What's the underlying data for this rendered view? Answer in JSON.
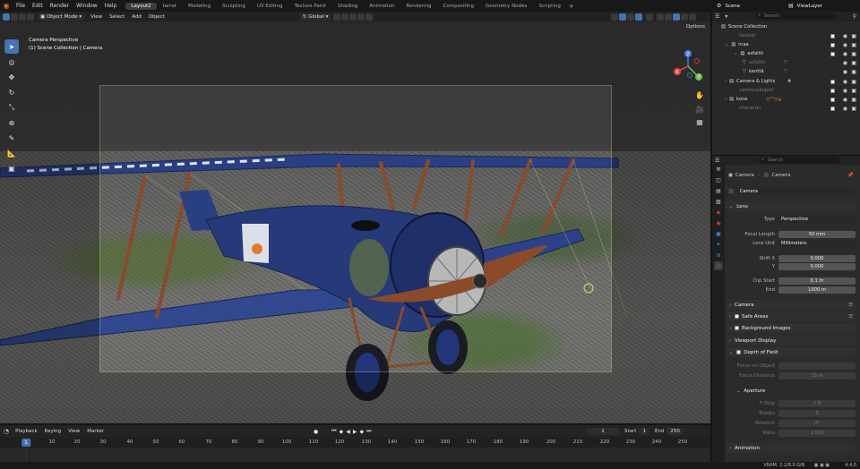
{
  "menubar": {
    "menus": [
      "File",
      "Edit",
      "Render",
      "Window",
      "Help"
    ],
    "workspaces": [
      "Layout2",
      "tarrat",
      "Modeling",
      "Sculpting",
      "UV Editing",
      "Texture Paint",
      "Shading",
      "Animation",
      "Rendering",
      "Compositing",
      "Geometry Nodes",
      "Scripting"
    ],
    "active_workspace": "Layout2",
    "scene": "Scene",
    "view_layer": "ViewLayer"
  },
  "viewport_header": {
    "mode": "Object Mode",
    "menus": [
      "View",
      "Select",
      "Add",
      "Object"
    ],
    "transform_orientation": "Global",
    "options": "Options"
  },
  "viewport": {
    "view_name": "Camera Perspective",
    "collection_path": "(1) Scene Collection | Camera",
    "gizmo_axes": [
      "Z",
      "X",
      "Y"
    ]
  },
  "timeline": {
    "menus": [
      "Playback",
      "Keying",
      "View",
      "Marker"
    ],
    "current_frame": "1",
    "start_label": "Start",
    "start": "1",
    "end_label": "End",
    "end": "250",
    "ticks": [
      "1",
      "10",
      "20",
      "30",
      "40",
      "50",
      "60",
      "70",
      "80",
      "90",
      "100",
      "110",
      "120",
      "130",
      "140",
      "150",
      "160",
      "170",
      "180",
      "190",
      "200",
      "210",
      "220",
      "230",
      "240",
      "250"
    ]
  },
  "outliner": {
    "search_placeholder": "Search",
    "rows": [
      {
        "label": "Scene Collection",
        "dim": false
      },
      {
        "label": "taustat",
        "dim": true
      },
      {
        "label": "maa",
        "dim": false
      },
      {
        "label": "asfaltti",
        "dim": false
      },
      {
        "label": "asfaltti",
        "dim": true
      },
      {
        "label": "kenttä",
        "dim": false
      },
      {
        "label": "Camera & Lights",
        "dim": false
      },
      {
        "label": "varmuuskopiot",
        "dim": true
      },
      {
        "label": "kone",
        "dim": false
      },
      {
        "label": "character",
        "dim": true
      }
    ]
  },
  "properties": {
    "search_placeholder": "Search",
    "breadcrumb": [
      "Camera",
      "Camera"
    ],
    "datablock": "Camera",
    "lens_section": "Lens",
    "fields": [
      {
        "label": "Type",
        "value": "Perspective"
      },
      {
        "label": "Focal Length",
        "value": "50 mm"
      },
      {
        "label": "Lens Unit",
        "value": "Millimeters"
      },
      {
        "label": "Shift X",
        "value": "0.000"
      },
      {
        "label": "Y",
        "value": "0.000"
      },
      {
        "label": "Clip Start",
        "value": "0.1 m"
      },
      {
        "label": "End",
        "value": "1000 m"
      }
    ],
    "sections": [
      "Camera",
      "Safe Areas",
      "Background Images",
      "Viewport Display",
      "Depth of Field"
    ],
    "dof": [
      {
        "label": "Focus on Object",
        "value": ""
      },
      {
        "label": "Focus Distance",
        "value": "10 m"
      }
    ],
    "aperture_section": "Aperture",
    "aperture": [
      {
        "label": "F-Stop",
        "value": "2.8"
      },
      {
        "label": "Blades",
        "value": "0"
      },
      {
        "label": "Rotation",
        "value": "0°"
      },
      {
        "label": "Ratio",
        "value": "1.000"
      }
    ],
    "animation_section": "Animation"
  },
  "statusbar": {
    "vram": "VRAM: 2.2/8.0 GiB",
    "version": "4.4.0"
  },
  "colors": {
    "accent": "#4772b3",
    "blender_orange": "#e87d0d",
    "plane_blue": "#263a7a",
    "strut_brown": "#8a4a2c"
  }
}
